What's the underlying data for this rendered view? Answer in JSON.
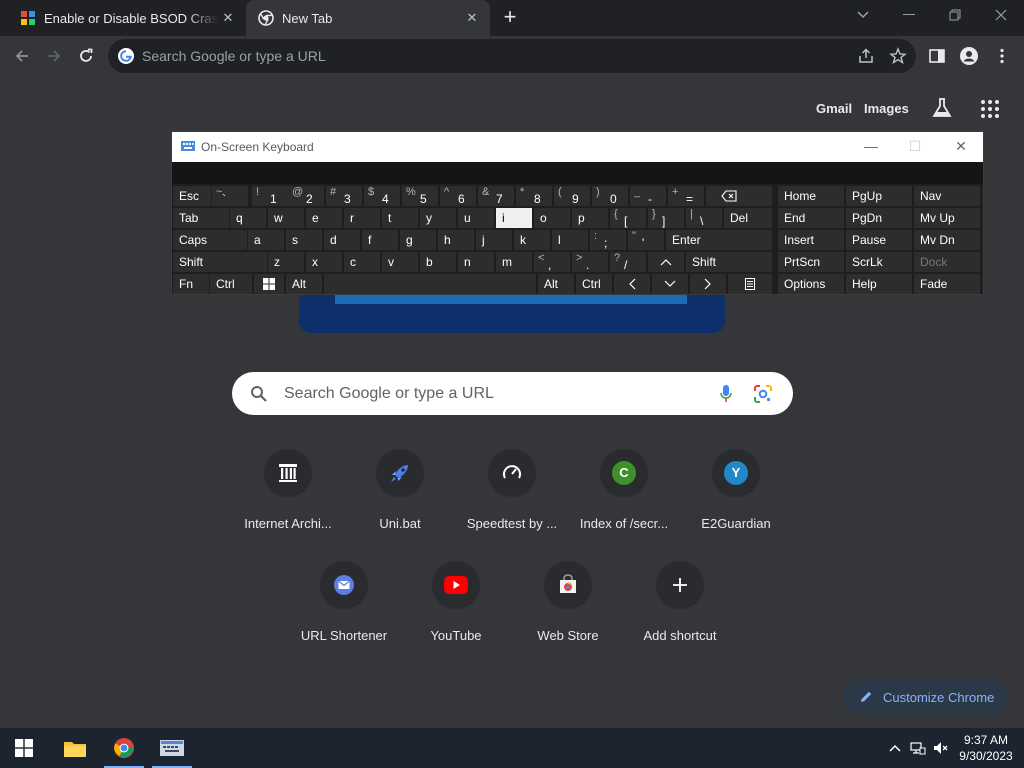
{
  "tabs": [
    {
      "title": "Enable or Disable BSOD Crash on",
      "active": false
    },
    {
      "title": "New Tab",
      "active": true
    }
  ],
  "omnibox": {
    "placeholder": "Search Google or type a URL"
  },
  "ntp": {
    "gmail": "Gmail",
    "images": "Images",
    "search_placeholder": "Search Google or type a URL",
    "shortcuts": [
      {
        "label": "Internet Archi...",
        "icon": "archive-icon"
      },
      {
        "label": "Uni.bat",
        "icon": "rocket-icon"
      },
      {
        "label": "Speedtest by ...",
        "icon": "speedometer-icon"
      },
      {
        "label": "Index of /secr...",
        "icon": "letter-c-icon",
        "letter": "C",
        "color": "#3f8f2a"
      },
      {
        "label": "E2Guardian",
        "icon": "letter-y-icon",
        "letter": "Y",
        "color": "#1e88c8"
      },
      {
        "label": "URL Shortener",
        "icon": "envelope-icon"
      },
      {
        "label": "YouTube",
        "icon": "youtube-icon"
      },
      {
        "label": "Web Store",
        "icon": "webstore-icon"
      },
      {
        "label": "Add shortcut",
        "icon": "plus-icon"
      }
    ],
    "customize": "Customize Chrome"
  },
  "osk": {
    "title": "On-Screen Keyboard",
    "keys": {
      "esc": "Esc",
      "tab": "Tab",
      "caps": "Caps",
      "shift_l": "Shift",
      "fn": "Fn",
      "ctrl_l": "Ctrl",
      "alt_l": "Alt",
      "alt_r": "Alt",
      "ctrl_r": "Ctrl",
      "del": "Del",
      "enter": "Enter",
      "shift_r": "Shift",
      "home": "Home",
      "pgup": "PgUp",
      "nav": "Nav",
      "end": "End",
      "pgdn": "PgDn",
      "mvup": "Mv Up",
      "insert": "Insert",
      "pause": "Pause",
      "mvdn": "Mv Dn",
      "prtscn": "PrtScn",
      "scrlk": "ScrLk",
      "dock": "Dock",
      "options": "Options",
      "help": "Help",
      "fade": "Fade",
      "num": [
        {
          "sh": "~",
          "mn": "`"
        },
        {
          "sh": "!",
          "mn": "1"
        },
        {
          "sh": "@",
          "mn": "2"
        },
        {
          "sh": "#",
          "mn": "3"
        },
        {
          "sh": "$",
          "mn": "4"
        },
        {
          "sh": "%",
          "mn": "5"
        },
        {
          "sh": "^",
          "mn": "6"
        },
        {
          "sh": "&",
          "mn": "7"
        },
        {
          "sh": "*",
          "mn": "8"
        },
        {
          "sh": "(",
          "mn": "9"
        },
        {
          "sh": ")",
          "mn": "0"
        },
        {
          "sh": "_",
          "mn": "-"
        },
        {
          "sh": "+",
          "mn": "="
        }
      ],
      "row_q": [
        "q",
        "w",
        "e",
        "r",
        "t",
        "y",
        "u",
        "i",
        "o",
        "p"
      ],
      "brackets": [
        {
          "sh": "{",
          "mn": "["
        },
        {
          "sh": "}",
          "mn": "]"
        },
        {
          "sh": "|",
          "mn": "\\"
        }
      ],
      "row_a": [
        "a",
        "s",
        "d",
        "f",
        "g",
        "h",
        "j",
        "k",
        "l"
      ],
      "semi": [
        {
          "sh": ":",
          "mn": ";"
        },
        {
          "sh": "\"",
          "mn": "'"
        }
      ],
      "row_z": [
        "z",
        "x",
        "c",
        "v",
        "b",
        "n",
        "m"
      ],
      "punct": [
        {
          "sh": "<",
          "mn": ","
        },
        {
          "sh": ">",
          "mn": "."
        },
        {
          "sh": "?",
          "mn": "/"
        }
      ]
    }
  },
  "taskbar": {
    "time": "9:37 AM",
    "date": "9/30/2023"
  }
}
